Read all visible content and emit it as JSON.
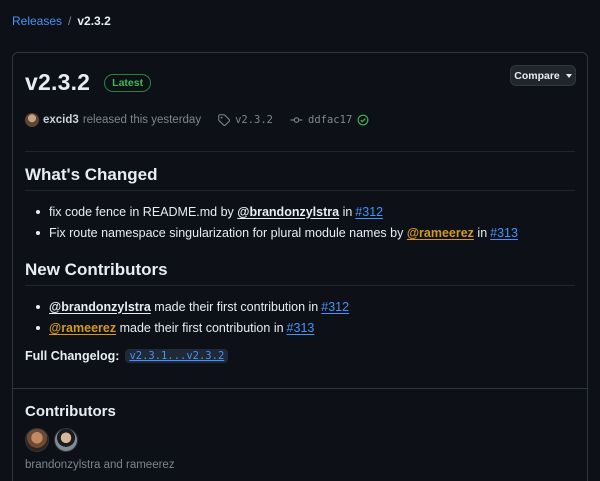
{
  "breadcrumb": {
    "parent": "Releases",
    "separator": "/",
    "current": "v2.3.2"
  },
  "release": {
    "title": "v2.3.2",
    "badge": "Latest",
    "compare_label": "Compare",
    "author": "excid3",
    "released_text": "released this yesterday",
    "tag": "v2.3.2",
    "commit": "ddfac17"
  },
  "whats_changed": {
    "heading": "What's Changed",
    "items": [
      {
        "text": "fix code fence in README.md by",
        "mention": "@brandonzylstra",
        "in": "in",
        "pr": "#312"
      },
      {
        "text": "Fix route namespace singularization for plural module names by",
        "mention": "@rameerez",
        "in": "in",
        "pr": "#313"
      }
    ]
  },
  "new_contributors": {
    "heading": "New Contributors",
    "items": [
      {
        "mention": "@brandonzylstra",
        "text": "made their first contribution in",
        "pr": "#312"
      },
      {
        "mention": "@rameerez",
        "text": "made their first contribution in",
        "pr": "#313"
      }
    ]
  },
  "changelog": {
    "label": "Full Changelog:",
    "link": "v2.3.1...v2.3.2"
  },
  "contributors": {
    "heading": "Contributors",
    "names": "brandonzylstra and rameerez"
  },
  "colors": {
    "accent": "#4493f8",
    "success": "#3fb950",
    "mention_orange": "#d29922",
    "background": "#0d1117"
  }
}
